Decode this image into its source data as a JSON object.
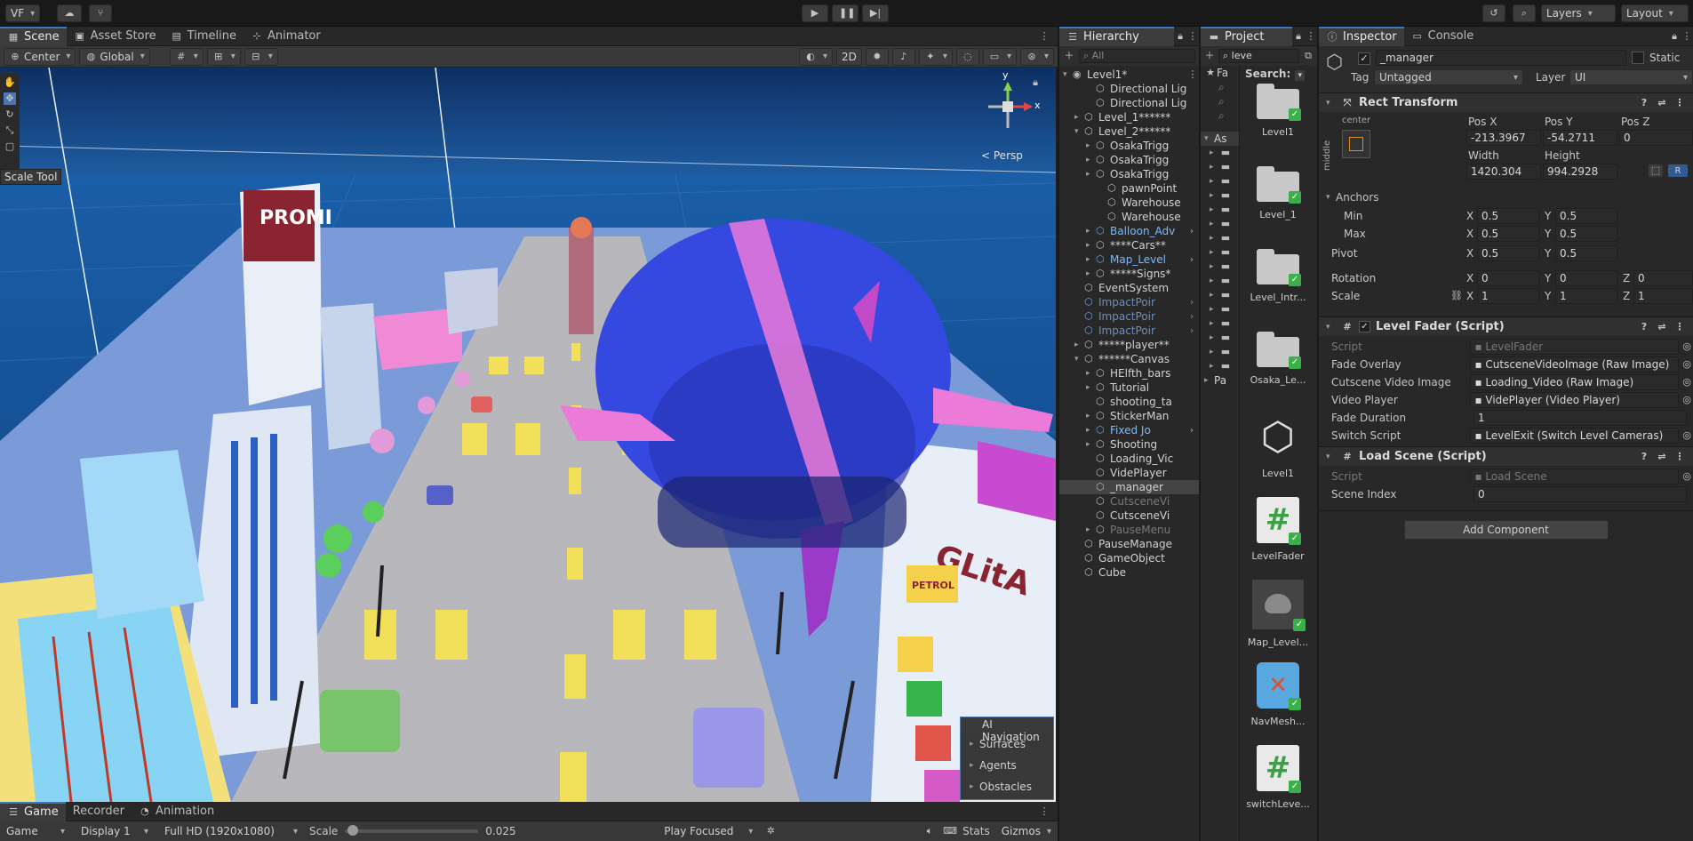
{
  "topbar": {
    "account_label": "VF",
    "layers_label": "Layers",
    "layout_label": "Layout"
  },
  "scene_tabs": [
    {
      "label": "Scene",
      "icon": "grid-icon"
    },
    {
      "label": "Asset Store",
      "icon": "store-icon"
    },
    {
      "label": "Timeline",
      "icon": "timeline-icon"
    },
    {
      "label": "Animator",
      "icon": "animator-icon"
    }
  ],
  "scene_toolbar": {
    "pivot_label": "Center",
    "space_label": "Global",
    "mode_2d": "2D"
  },
  "viewport": {
    "tooltip": "Scale Tool",
    "gizmo_projection": "Persp",
    "gizmo_axes": {
      "x": "x",
      "y": "y"
    },
    "nav_panel": {
      "title": "AI Navigation",
      "items": [
        "Surfaces",
        "Agents",
        "Obstacles"
      ]
    },
    "signs": {
      "promo": "PROMI",
      "glitch": "GLitA",
      "petrol": "PETROL"
    }
  },
  "hierarchy": {
    "title": "Hierarchy",
    "search_placeholder": "All",
    "rows": [
      {
        "label": "Level1*",
        "indent": 0,
        "arrow": "▾",
        "type": "scene"
      },
      {
        "label": "Directional Lig",
        "indent": 2,
        "arrow": "",
        "type": "obj"
      },
      {
        "label": "Directional Lig",
        "indent": 2,
        "arrow": "",
        "type": "obj"
      },
      {
        "label": "Level_1******",
        "indent": 1,
        "arrow": "▸",
        "type": "obj"
      },
      {
        "label": "Level_2******",
        "indent": 1,
        "arrow": "▾",
        "type": "obj"
      },
      {
        "label": "OsakaTrigg",
        "indent": 2,
        "arrow": "▸",
        "type": "obj"
      },
      {
        "label": "OsakaTrigg",
        "indent": 2,
        "arrow": "▸",
        "type": "obj"
      },
      {
        "label": "OsakaTrigg",
        "indent": 2,
        "arrow": "▸",
        "type": "obj"
      },
      {
        "label": "pawnPoint",
        "indent": 3,
        "arrow": "",
        "type": "obj"
      },
      {
        "label": "Warehouse",
        "indent": 3,
        "arrow": "",
        "type": "obj"
      },
      {
        "label": "Warehouse",
        "indent": 3,
        "arrow": "",
        "type": "obj"
      },
      {
        "label": "Balloon_Adv",
        "indent": 2,
        "arrow": "▸",
        "type": "prefab"
      },
      {
        "label": "****Cars**",
        "indent": 2,
        "arrow": "▸",
        "type": "obj"
      },
      {
        "label": "Map_Level",
        "indent": 2,
        "arrow": "▸",
        "type": "prefab"
      },
      {
        "label": "*****Signs*",
        "indent": 2,
        "arrow": "▸",
        "type": "obj"
      },
      {
        "label": "EventSystem",
        "indent": 1,
        "arrow": "",
        "type": "obj"
      },
      {
        "label": "ImpactPoir",
        "indent": 1,
        "arrow": "",
        "type": "prefab-dim"
      },
      {
        "label": "ImpactPoir",
        "indent": 1,
        "arrow": "",
        "type": "prefab-dim"
      },
      {
        "label": "ImpactPoir",
        "indent": 1,
        "arrow": "",
        "type": "prefab-dim"
      },
      {
        "label": "*****player**",
        "indent": 1,
        "arrow": "▸",
        "type": "obj"
      },
      {
        "label": "******Canvas",
        "indent": 1,
        "arrow": "▾",
        "type": "obj"
      },
      {
        "label": "HElfth_bars",
        "indent": 2,
        "arrow": "▸",
        "type": "obj"
      },
      {
        "label": "Tutorial",
        "indent": 2,
        "arrow": "▸",
        "type": "obj"
      },
      {
        "label": "shooting_ta",
        "indent": 2,
        "arrow": "",
        "type": "obj"
      },
      {
        "label": "StickerMan",
        "indent": 2,
        "arrow": "▸",
        "type": "obj"
      },
      {
        "label": "Fixed Jo",
        "indent": 2,
        "arrow": "▸",
        "type": "prefab"
      },
      {
        "label": "Shooting",
        "indent": 2,
        "arrow": "▸",
        "type": "obj"
      },
      {
        "label": "Loading_Vic",
        "indent": 2,
        "arrow": "",
        "type": "obj"
      },
      {
        "label": "VidePlayer",
        "indent": 2,
        "arrow": "",
        "type": "obj"
      },
      {
        "label": "_manager",
        "indent": 2,
        "arrow": "",
        "type": "selected"
      },
      {
        "label": "CutsceneVi",
        "indent": 2,
        "arrow": "",
        "type": "dim"
      },
      {
        "label": "CutsceneVi",
        "indent": 2,
        "arrow": "",
        "type": "obj"
      },
      {
        "label": "PauseMenu",
        "indent": 2,
        "arrow": "▸",
        "type": "dim"
      },
      {
        "label": "PauseManage",
        "indent": 1,
        "arrow": "",
        "type": "obj"
      },
      {
        "label": "GameObject",
        "indent": 1,
        "arrow": "",
        "type": "obj"
      },
      {
        "label": "Cube",
        "indent": 1,
        "arrow": "",
        "type": "obj"
      }
    ]
  },
  "project": {
    "title": "Project",
    "search_value": "leve",
    "search_label": "Search:",
    "tree": [
      "Fa",
      "As",
      "Pa"
    ],
    "assets": [
      {
        "label": "Level1",
        "kind": "folder"
      },
      {
        "label": "Level_1",
        "kind": "folder"
      },
      {
        "label": "Level_Intr...",
        "kind": "folder"
      },
      {
        "label": "Osaka_Le...",
        "kind": "folder"
      },
      {
        "label": "Level1",
        "kind": "unity"
      },
      {
        "label": "LevelFader",
        "kind": "script"
      },
      {
        "label": "Map_Level...",
        "kind": "model"
      },
      {
        "label": "NavMesh...",
        "kind": "navmesh"
      },
      {
        "label": "switchLeve...",
        "kind": "script"
      }
    ]
  },
  "inspector": {
    "tabs": [
      {
        "label": "Inspector",
        "icon": "info-icon"
      },
      {
        "label": "Console",
        "icon": "console-icon"
      }
    ],
    "object_name": "_manager",
    "static_label": "Static",
    "tag_label": "Tag",
    "tag_value": "Untagged",
    "layer_label": "Layer",
    "layer_value": "UI",
    "rect_transform": {
      "title": "Rect Transform",
      "anchor_h": "center",
      "anchor_v": "middle",
      "pos_x_label": "Pos X",
      "pos_x": "-213.3967",
      "pos_y_label": "Pos Y",
      "pos_y": "-54.2711",
      "pos_z_label": "Pos Z",
      "pos_z": "0",
      "width_label": "Width",
      "width": "1420.304",
      "height_label": "Height",
      "height": "994.2928",
      "r_button": "R",
      "anchors_label": "Anchors",
      "min_label": "Min",
      "min_x": "0.5",
      "min_y": "0.5",
      "max_label": "Max",
      "max_x": "0.5",
      "max_y": "0.5",
      "pivot_label": "Pivot",
      "pivot_x": "0.5",
      "pivot_y": "0.5",
      "rotation_label": "Rotation",
      "rot_x": "0",
      "rot_y": "0",
      "rot_z": "0",
      "scale_label": "Scale",
      "scale_x": "1",
      "scale_y": "1",
      "scale_z": "1",
      "x": "X",
      "y": "Y",
      "z": "Z"
    },
    "level_fader": {
      "title": "Level Fader (Script)",
      "props": [
        {
          "label": "Script",
          "value": "LevelFader",
          "dim": true
        },
        {
          "label": "Fade Overlay",
          "value": "CutsceneVideoImage (Raw Image)",
          "dim": false
        },
        {
          "label": "Cutscene Video Image",
          "value": "Loading_Video (Raw Image)",
          "dim": false
        },
        {
          "label": "Video Player",
          "value": "VidePlayer (Video Player)",
          "dim": false
        },
        {
          "label": "Fade Duration",
          "value": "1",
          "dim": false
        },
        {
          "label": "Switch Script",
          "value": "LevelExit (Switch Level Cameras)",
          "dim": false
        }
      ]
    },
    "load_scene": {
      "title": "Load Scene (Script)",
      "props": [
        {
          "label": "Script",
          "value": "Load Scene",
          "dim": true
        },
        {
          "label": "Scene Index",
          "value": "0",
          "dim": false
        }
      ]
    },
    "add_component": "Add Component"
  },
  "bottom": {
    "tabs": [
      {
        "label": "Game",
        "icon": "game-icon"
      },
      {
        "label": "Recorder",
        "icon": ""
      },
      {
        "label": "Animation",
        "icon": "animation-icon"
      }
    ],
    "game_label": "Game",
    "display_label": "Display 1",
    "resolution_label": "Full HD (1920x1080)",
    "scale_label": "Scale",
    "scale_value": "0.025",
    "scale_fraction": 0.02,
    "play_focused": "Play Focused",
    "stats_label": "Stats",
    "gizmos_label": "Gizmos"
  },
  "colors": {
    "accent": "#3a79bb",
    "selection": "#444444",
    "prefab": "#7cb8ff",
    "check": "#3bb04a"
  }
}
